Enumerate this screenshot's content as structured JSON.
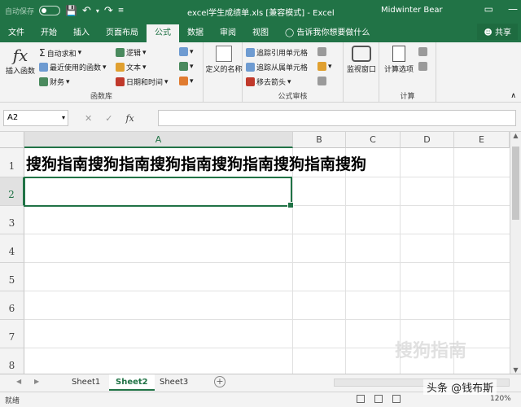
{
  "titlebar": {
    "autosave_label": "自动保存",
    "autosave_state": "●关",
    "title": "excel学生成绩单.xls  [兼容模式]  -  Excel",
    "user": "Midwinter Bear",
    "icons": [
      "save-icon",
      "undo-icon",
      "redo-icon",
      "customize-icon"
    ]
  },
  "tabs": [
    "文件",
    "开始",
    "插入",
    "页面布局",
    "公式",
    "数据",
    "审阅",
    "视图"
  ],
  "active_tab": "公式",
  "tell_me": "告诉我你想要做什么",
  "share_label": "共享",
  "ribbon": {
    "insert_function": "插入函数",
    "func_library": [
      "自动求和",
      "最近使用的函数",
      "财务",
      "逻辑",
      "文本",
      "日期和时间"
    ],
    "func_library_label": "函数库",
    "define_name": "定义的名称",
    "audit": [
      "追踪引用单元格",
      "追踪从属单元格",
      "移去箭头"
    ],
    "watch_window": "监视窗口",
    "audit_label": "公式审核",
    "calc_options": "计算选项",
    "calc_label": "计算"
  },
  "formula_bar": {
    "namebox": "A2",
    "fx": "fx",
    "value": ""
  },
  "columns": [
    "A",
    "B",
    "C",
    "D",
    "E"
  ],
  "rows": [
    "1",
    "2",
    "3",
    "4",
    "5",
    "6",
    "7",
    "8"
  ],
  "cells": {
    "A1": "搜狗指南搜狗指南搜狗指南搜狗指南搜狗指南搜狗"
  },
  "sheets": [
    "Sheet1",
    "Sheet2",
    "Sheet3"
  ],
  "active_sheet": "Sheet2",
  "status": {
    "ready": "就绪",
    "zoom": "120%"
  },
  "watermark": {
    "overlay": "头条 @钱布斯",
    "logo_text": "搜狗指南"
  },
  "colors": {
    "excel_green": "#217346"
  }
}
